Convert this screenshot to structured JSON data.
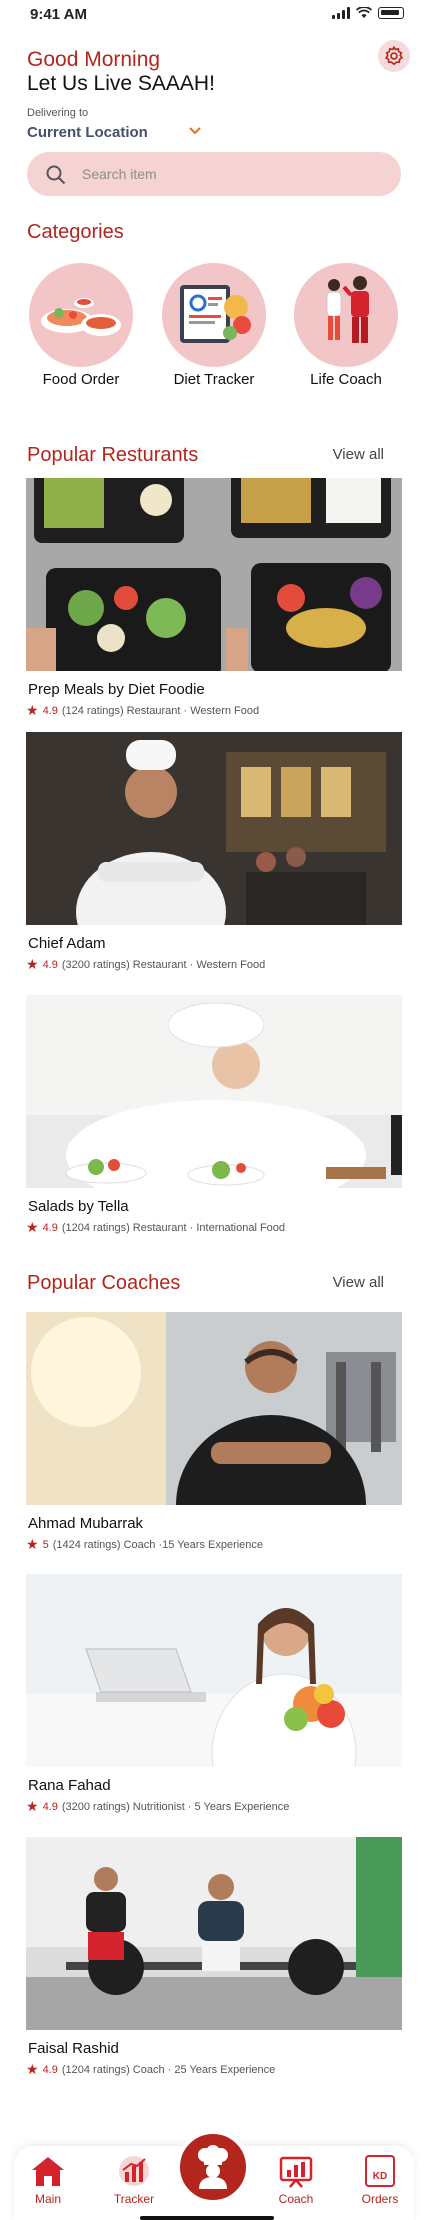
{
  "status": {
    "time": "9:41 AM"
  },
  "header": {
    "greeting": "Good Morning",
    "tagline": "Let Us Live SAAAH!",
    "deliver_label": "Delivering to",
    "location": "Current Location"
  },
  "search": {
    "placeholder": "Search item"
  },
  "categories": {
    "title": "Categories",
    "items": [
      {
        "label": "Food Order"
      },
      {
        "label": "Diet Tracker"
      },
      {
        "label": "Life Coach"
      }
    ]
  },
  "restaurants": {
    "title": "Popular Resturants",
    "view_all": "View all",
    "items": [
      {
        "name": "Prep Meals by Diet Foodie",
        "rating": "4.9",
        "details": "(124 ratings) Restaurant · Western Food"
      },
      {
        "name": "Chief Adam",
        "rating": "4.9",
        "details": "(3200 ratings) Restaurant · Western Food"
      },
      {
        "name": "Salads by Tella",
        "rating": "4.9",
        "details": "(1204 ratings) Restaurant · International Food"
      }
    ]
  },
  "coaches": {
    "title": "Popular Coaches",
    "view_all": "View all",
    "items": [
      {
        "name": "Ahmad Mubarrak",
        "rating": "5",
        "details": "(1424 ratings) Coach ·15 Years Experience"
      },
      {
        "name": "Rana Fahad",
        "rating": "4.9",
        "details": "(3200 ratings) Nutritionist · 5 Years Experience"
      },
      {
        "name": "Faisal Rashid",
        "rating": "4.9",
        "details": "(1204 ratings) Coach · 25 Years Experience"
      }
    ]
  },
  "nav": {
    "main": "Main",
    "tracker": "Tracker",
    "coach": "Coach",
    "orders": "Orders",
    "orders_badge": "KD"
  },
  "colors": {
    "accent": "#b3261e",
    "pink": "#f5d3d2"
  }
}
